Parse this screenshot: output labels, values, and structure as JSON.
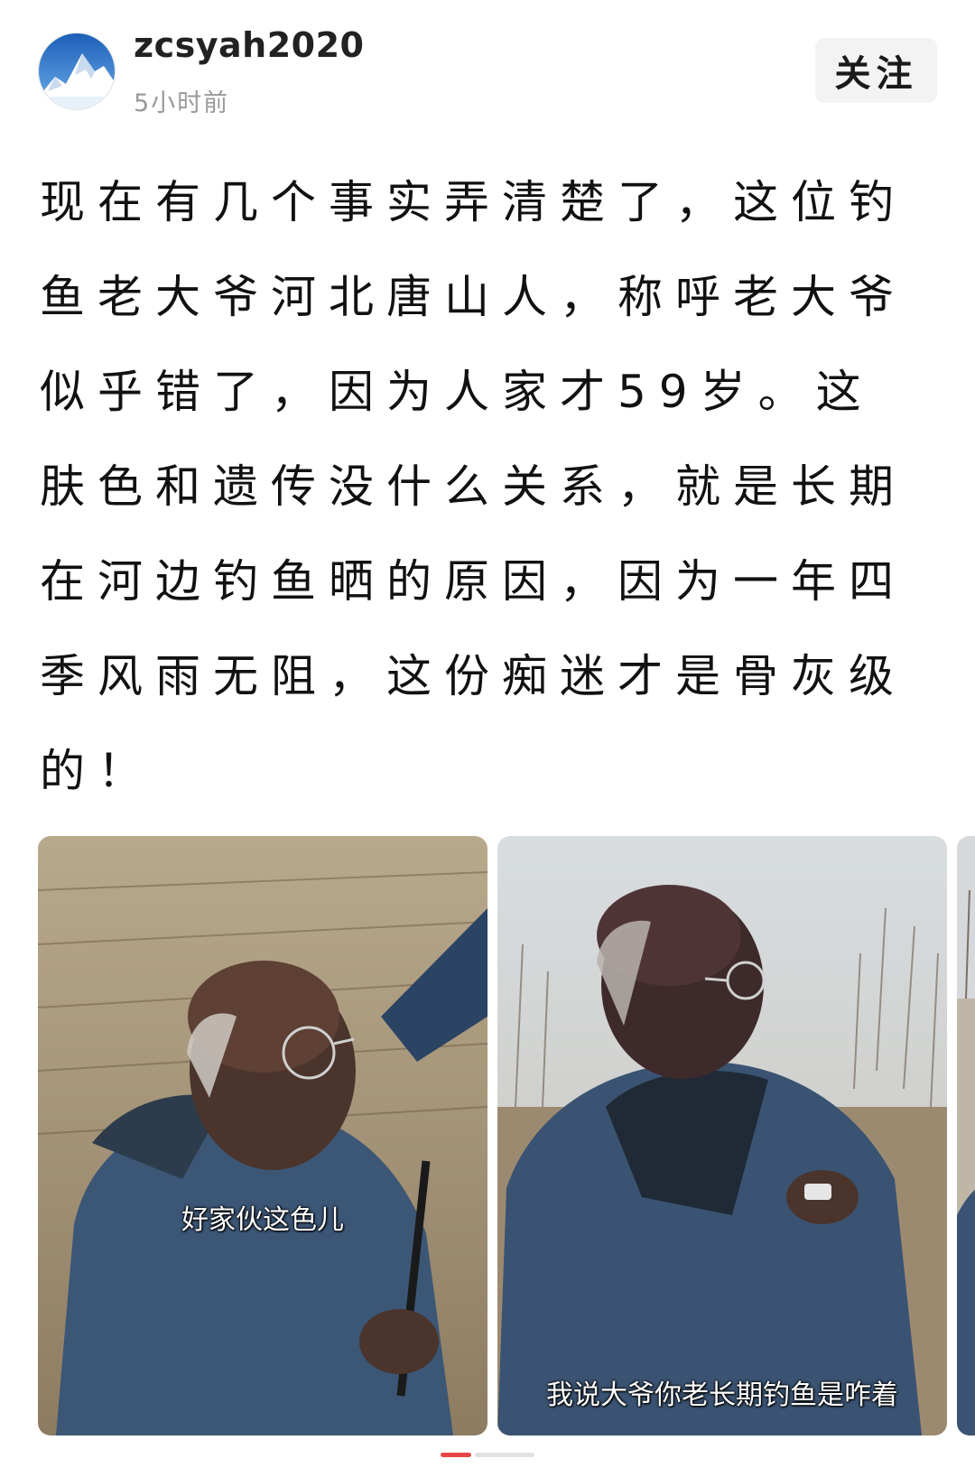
{
  "post": {
    "author": {
      "username": "zcsyah2020",
      "avatar_icon": "mountain-avatar-icon",
      "timestamp": "5小时前"
    },
    "follow_label": "关注",
    "text": "现在有几个事实弄清楚了，这位钓鱼老大爷河北唐山人，称呼老大爷似乎错了，因为人家才59岁。这肤色和遗传没什么关系，就是长期在河边钓鱼晒的原因，因为一年四季风雨无阻，这份痴迷才是骨灰级的！",
    "images": [
      {
        "caption": "好家伙这色儿"
      },
      {
        "caption": "我说大爷你老长期钓鱼是咋着"
      }
    ]
  },
  "colors": {
    "accent": "#e84545",
    "follow_bg": "#f3f3f3",
    "timestamp": "#9a9a9a"
  }
}
